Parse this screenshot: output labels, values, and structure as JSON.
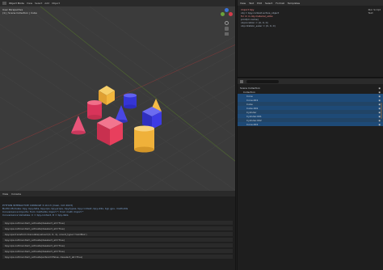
{
  "viewport": {
    "header_menus": [
      "View",
      "Select",
      "Add",
      "Object"
    ],
    "mode": "Object Mode",
    "info_line1": "User Perspective",
    "info_line2": "(1) | Scene Collection | Cube",
    "colors": {
      "background": "#3b3b3b",
      "yellow": "#f2b63d",
      "red": "#e83f5d",
      "blue": "#3d3be4"
    },
    "objects": [
      "yellow cube",
      "red cylinder",
      "blue cylinder",
      "blue cone",
      "yellow cone",
      "red cone",
      "red cube",
      "blue cube",
      "yellow cylinder"
    ]
  },
  "editor": {
    "header_items": [
      "View",
      "Text",
      "Edit",
      "Select",
      "Format",
      "Templates"
    ],
    "lines": [
      "import bpy",
      "",
      "obj = bpy.context.active_object",
      "for m in obj.material_slots:",
      "    print(m.name)",
      "",
      "obj.location = (0, 0, 0)",
      "obj.rotation_euler = (0, 0, 0)"
    ],
    "side_lines": [
      "Run Script",
      "Text"
    ]
  },
  "console": {
    "header_items": [
      "View",
      "Console"
    ],
    "lines": [
      "PYTHON INTERACTIVE CONSOLE 3.10.13 (main, Oct 2023)",
      "Builtin Modules: bpy, bpy.data, bpy.ops, bpy.props, bpy.types, bpy.context, bpy.utils, bgl, gpu, mathutils",
      "Convenience Imports: from mathutils import *; from math import *",
      "Convenience Variables: C = bpy.context, D = bpy.data"
    ],
    "history": [
      "bpy.ops.outliner.item_activate(deselect_all=True)",
      "bpy.ops.outliner.item_activate(deselect_all=True)",
      "bpy.ops.transform.translate(value=(0, 0, 1), orient_type='GLOBAL')",
      "bpy.ops.outliner.item_activate(deselect_all=True)",
      "bpy.ops.outliner.item_activate(deselect_all=True)",
      "bpy.ops.outliner.item_activate(deselect_all=True)",
      "bpy.ops.outliner.item_activate(extend=False, deselect_all=True)"
    ]
  },
  "outliner": {
    "title": "Scene Collection",
    "rows": [
      {
        "label": "Collection",
        "selected": false
      },
      {
        "label": "Cone",
        "selected": true
      },
      {
        "label": "Cone.001",
        "selected": true
      },
      {
        "label": "Cube",
        "selected": true
      },
      {
        "label": "Cube.001",
        "selected": true
      },
      {
        "label": "Cylinder",
        "selected": true
      },
      {
        "label": "Cylinder.001",
        "selected": true
      },
      {
        "label": "Cylinder.002",
        "selected": true
      },
      {
        "label": "Cone.002",
        "selected": true
      }
    ]
  }
}
